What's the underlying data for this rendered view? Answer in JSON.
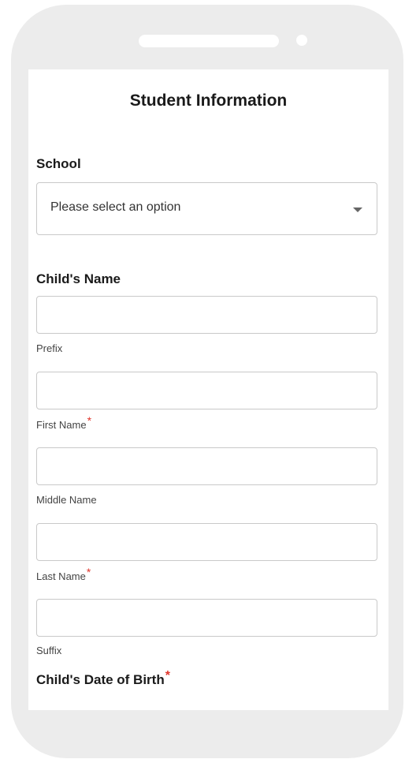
{
  "form": {
    "title": "Student Information",
    "school": {
      "label": "School",
      "selected": "Please select an option"
    },
    "childs_name": {
      "label": "Child's Name",
      "fields": [
        {
          "label": "Prefix",
          "value": "",
          "required": false
        },
        {
          "label": "First Name",
          "value": "",
          "required": true
        },
        {
          "label": "Middle Name",
          "value": "",
          "required": false
        },
        {
          "label": "Last Name",
          "value": "",
          "required": true
        },
        {
          "label": "Suffix",
          "value": "",
          "required": false
        }
      ]
    },
    "dob": {
      "label": "Child's Date of Birth",
      "required": true
    },
    "required_marker": "*"
  },
  "colors": {
    "required": "#e0352b",
    "phone_frame": "#ececec",
    "border": "#c9c9c9"
  }
}
